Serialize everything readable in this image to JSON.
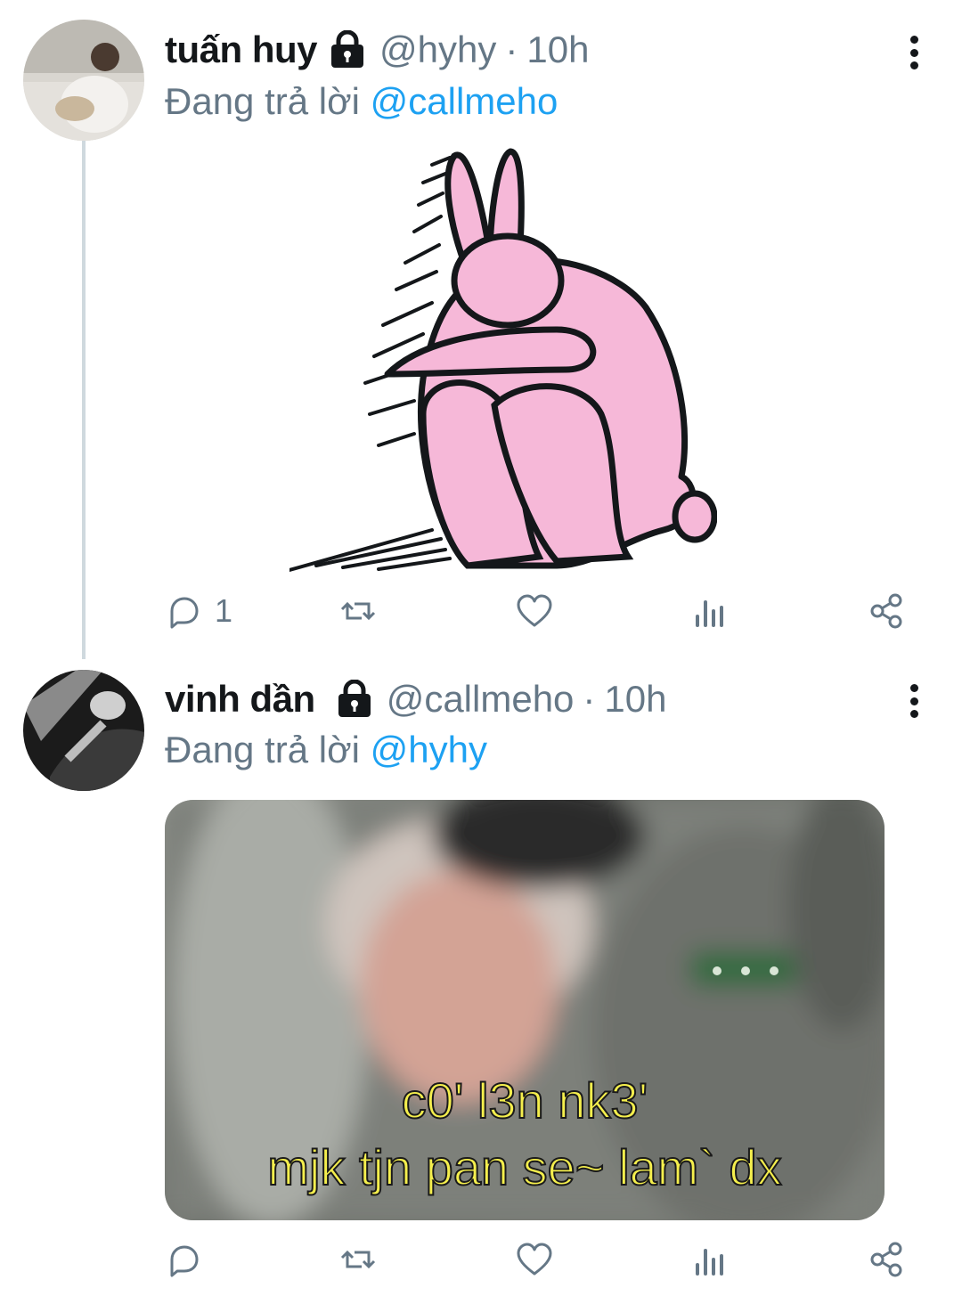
{
  "tweets": [
    {
      "display_name": "tuấn huy",
      "handle": "@hyhy",
      "separator": "·",
      "time": "10h",
      "reply_prefix": "Đang trả lời",
      "reply_to": "@callmeho",
      "media_type": "sticker",
      "reply_count": "1"
    },
    {
      "display_name": "vinh dần",
      "handle": "@callmeho",
      "separator": "·",
      "time": "10h",
      "reply_prefix": "Đang trả lời",
      "reply_to": "@hyhy",
      "media_type": "photo",
      "meme_line_1": "c0' l3n nk3'",
      "meme_line_2": "mjk tjn pan se~ lam` dx",
      "reply_count": ""
    }
  ],
  "icons": {
    "lock": "lock-icon",
    "reply": "reply-icon",
    "retweet": "retweet-icon",
    "like": "heart-icon",
    "analytics": "analytics-icon",
    "share": "share-icon",
    "more": "more-vertical-icon"
  },
  "colors": {
    "name": "#14171a",
    "secondary": "#657786",
    "mention": "#1da1f2",
    "sticker_pink": "#f6b8d8",
    "meme_text": "#f5ef4d"
  }
}
